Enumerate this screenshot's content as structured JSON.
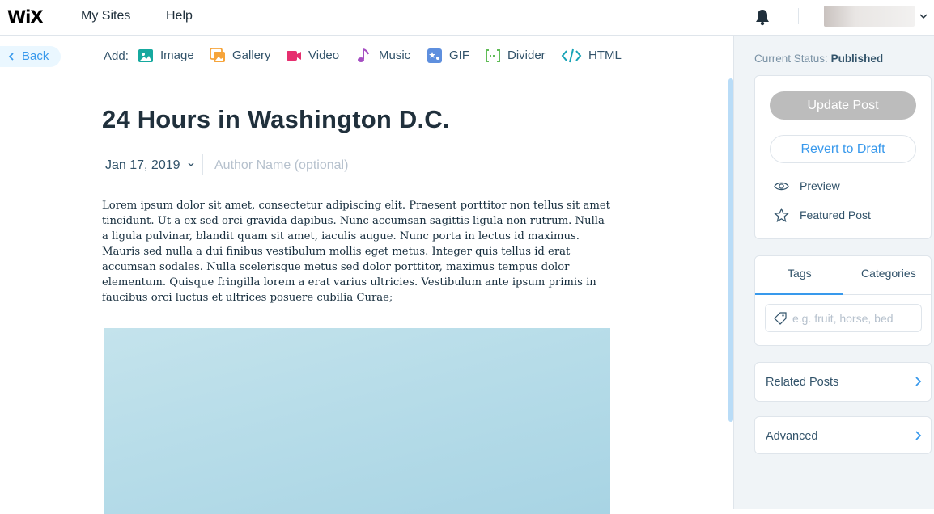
{
  "header": {
    "logo": "WiX",
    "nav": [
      {
        "label": "My Sites"
      },
      {
        "label": "Help"
      }
    ]
  },
  "toolbar": {
    "back_label": "Back",
    "add_label": "Add:",
    "tools": [
      {
        "label": "Image",
        "icon": "image-icon",
        "color": "#16a99f"
      },
      {
        "label": "Gallery",
        "icon": "gallery-icon",
        "color": "#f6a43a"
      },
      {
        "label": "Video",
        "icon": "video-icon",
        "color": "#e62f6f"
      },
      {
        "label": "Music",
        "icon": "music-icon",
        "color": "#a54ec2"
      },
      {
        "label": "GIF",
        "icon": "gif-icon",
        "color": "#5e8fde"
      },
      {
        "label": "Divider",
        "icon": "divider-icon",
        "color": "#60bc57"
      },
      {
        "label": "HTML",
        "icon": "html-icon",
        "color": "#17a3b6"
      }
    ]
  },
  "post": {
    "title": "24 Hours in Washington D.C.",
    "date": "Jan 17, 2019",
    "author_placeholder": "Author Name (optional)",
    "body": "Lorem ipsum dolor sit amet, consectetur adipiscing elit. Praesent porttitor non tellus sit amet tincidunt. Ut a ex sed orci gravida dapibus. Nunc accumsan sagittis ligula non rutrum. Nulla a ligula pulvinar, blandit quam sit amet, iaculis augue. Nunc porta in lectus id maximus. Mauris sed nulla a dui finibus vestibulum mollis eget metus. Integer quis tellus id erat accumsan sodales. Nulla scelerisque metus sed dolor porttitor, maximus tempus dolor elementum. Quisque fringilla lorem a erat varius ultricies. Vestibulum ante ipsum primis in faucibus orci luctus et ultrices posuere cubilia Curae;"
  },
  "sidebar": {
    "status_label": "Current Status:",
    "status_value": "Published",
    "update_button": "Update Post",
    "revert_button": "Revert to Draft",
    "actions": [
      {
        "label": "Preview",
        "icon": "eye-icon"
      },
      {
        "label": "Featured Post",
        "icon": "star-icon"
      }
    ],
    "tabs": [
      {
        "label": "Tags",
        "active": true
      },
      {
        "label": "Categories",
        "active": false
      }
    ],
    "tags_placeholder": "e.g. fruit, horse, bed",
    "related_posts": "Related Posts",
    "advanced": "Advanced"
  },
  "colors": {
    "accent": "#3899ec",
    "text_dark": "#20303c",
    "update_disabled": "#bcbcbc"
  }
}
